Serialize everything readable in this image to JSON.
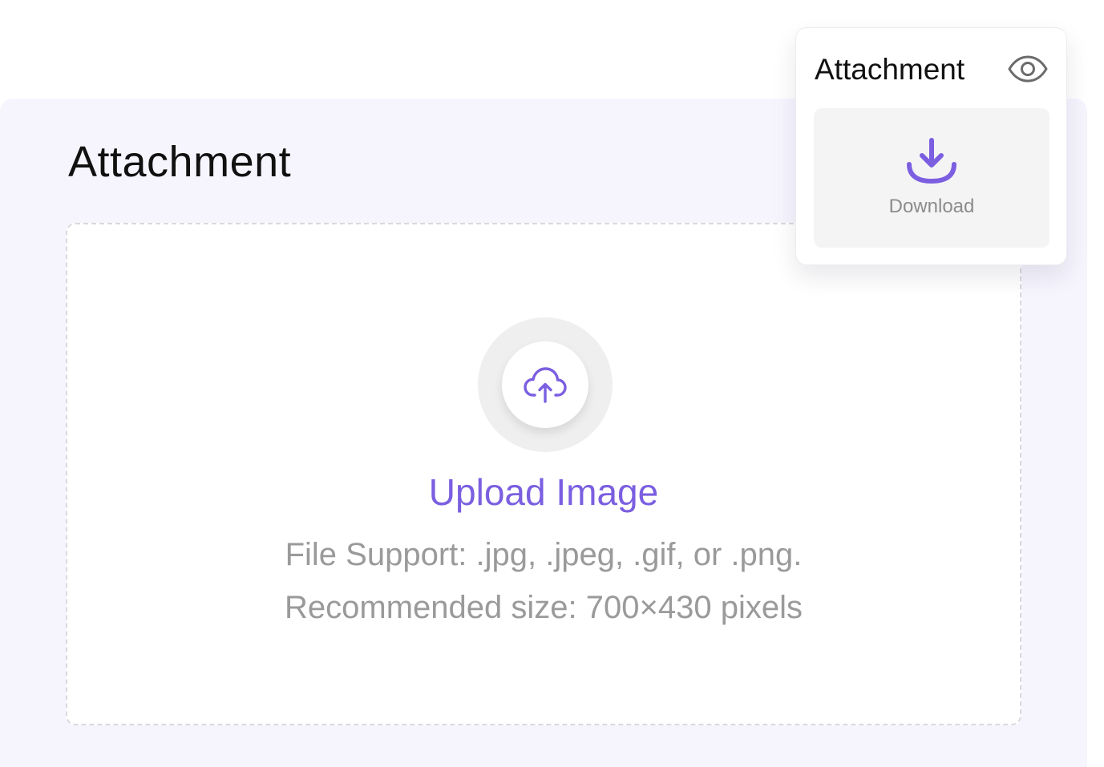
{
  "card": {
    "title": "Attachment"
  },
  "upload": {
    "icon": "cloud-upload-icon",
    "label": "Upload Image",
    "file_support": "File Support: .jpg, .jpeg, .gif, or .png.",
    "recommended_size": "Recommended size: 700×430 pixels"
  },
  "popover": {
    "title": "Attachment",
    "preview_icon": "eye-icon",
    "download_icon": "download-icon",
    "download_label": "Download"
  },
  "colors": {
    "accent": "#7b5fe0",
    "card_background": "#f6f5fe",
    "muted_text": "#9a9a9a"
  }
}
